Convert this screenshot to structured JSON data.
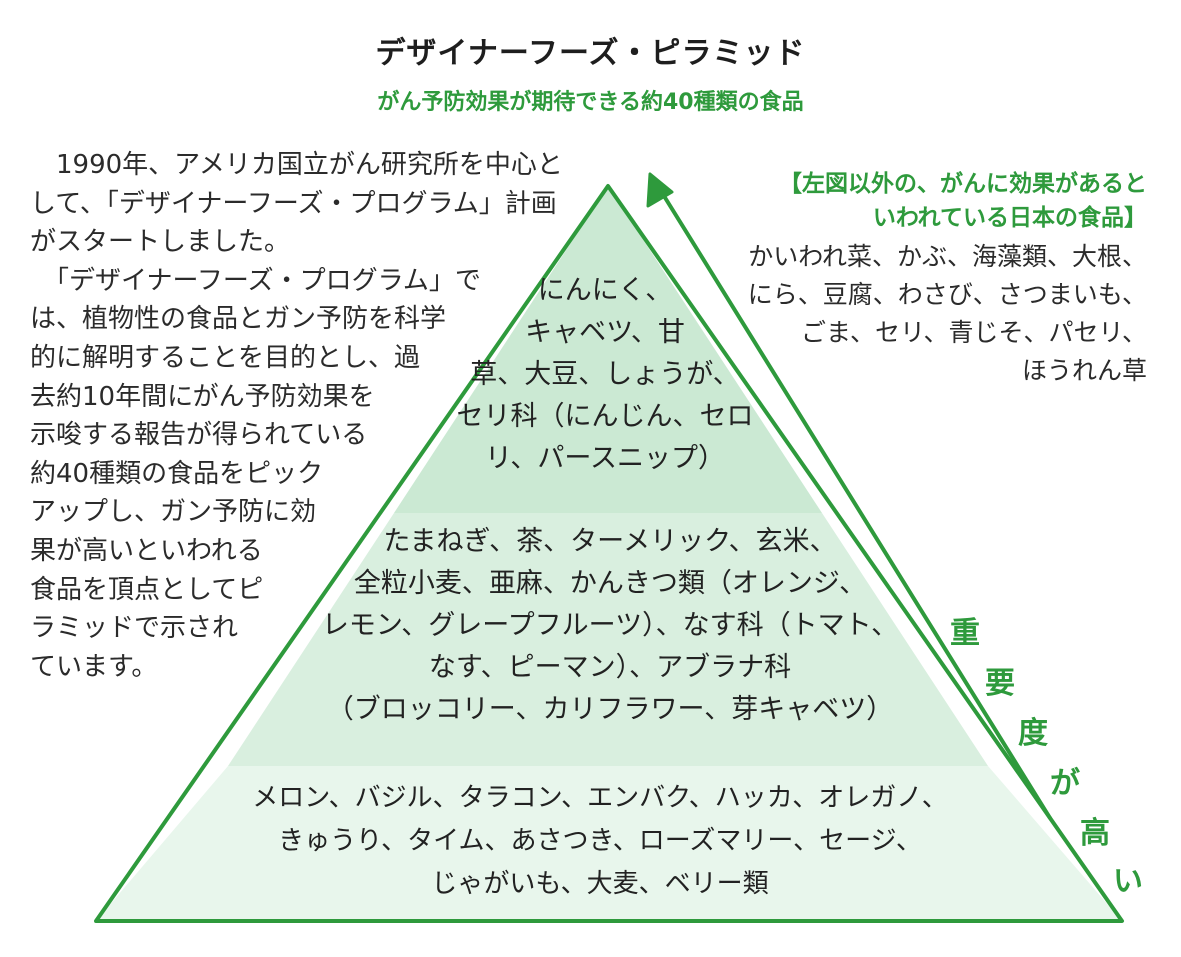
{
  "title": "デザイナーフーズ・ピラミッド",
  "subtitle": "がん予防効果が期待できる約40種類の食品",
  "intro_lines": [
    "　1990年、アメリカ国立がん研究所を中心と",
    "して、「デザイナーフーズ・プログラム」計画",
    "がスタートしました。",
    "　「デザイナーフーズ・プログラム」で",
    "は、植物性の食品とガン予防を科学",
    "的に解明することを目的とし、過",
    "去約10年間にがん予防効果を",
    "示唆する報告が得られている",
    "約40種類の食品をピック",
    "アップし、ガン予防に効",
    "果が高いといわれる",
    "食品を頂点としてピ",
    "ラミッドで示され",
    "ています。"
  ],
  "side_heading_lines": [
    "【左図以外の、がんに効果があると",
    "いわれている日本の食品】"
  ],
  "side_body_lines": [
    "かいわれ菜、かぶ、海藻類、大根、",
    "にら、豆腐、わさび、さつまいも、",
    "ごま、セリ、青じそ、パセリ、",
    "ほうれん草"
  ],
  "tiers": {
    "top": [
      "にんにく、",
      "キャベツ、甘",
      "草、大豆、しょうが、",
      "セリ科（にんじん、セロ",
      "リ、パースニップ）"
    ],
    "middle": [
      "たまねぎ、茶、ターメリック、玄米、",
      "全粒小麦、亜麻、かんきつ類（オレンジ、",
      "レモン、グレープフルーツ）、なす科（トマト、",
      "なす、ピーマン）、アブラナ科",
      "（ブロッコリー、カリフラワー、芽キャベツ）"
    ],
    "bottom": [
      "メロン、バジル、タラコン、エンバク、ハッカ、オレガノ、",
      "きゅうり、タイム、あさつき、ローズマリー、セージ、",
      "じゃがいも、大麦、ベリー類"
    ]
  },
  "arrow_label_chars": [
    "重",
    "要",
    "度",
    "が",
    "高",
    "い"
  ],
  "colors": {
    "accent_green": "#2e9a3c",
    "tier_fill_dark": "#cbe9d3",
    "tier_fill_mid": "#d9efdf",
    "tier_fill_light": "#e8f6ec"
  }
}
